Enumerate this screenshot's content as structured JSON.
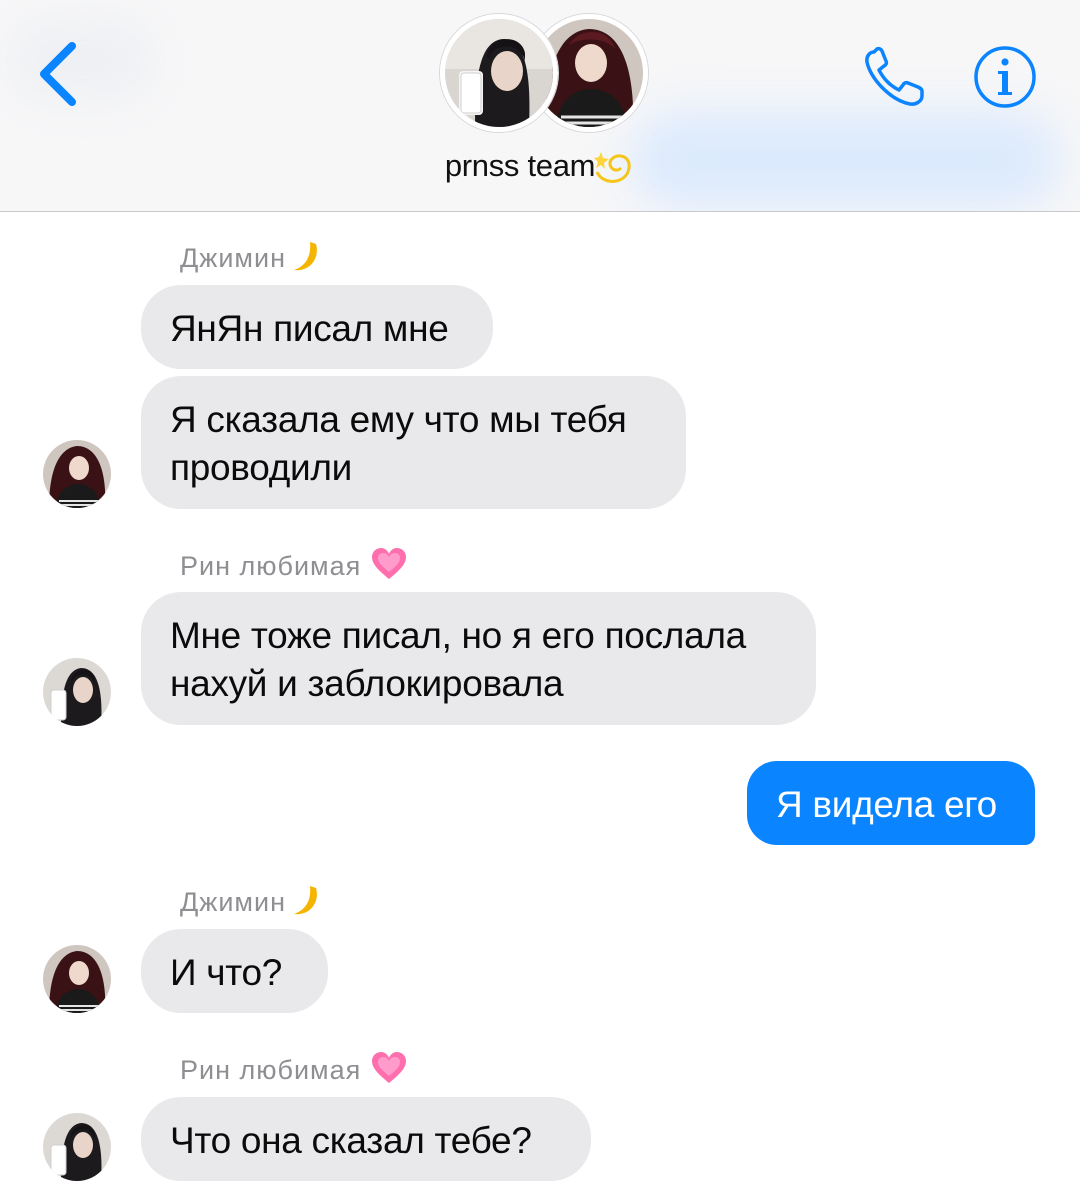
{
  "header": {
    "group_name": "prnss team",
    "group_emoji": "dizzy-emoji",
    "back_icon": "chevron-left-icon",
    "call_icon": "phone-icon",
    "info_icon": "info-icon"
  },
  "colors": {
    "accent": "#0a84ff",
    "incoming_bubble": "#e9e9eb",
    "sender_name": "#8e8e93"
  },
  "messages": [
    {
      "sender": "Джимин",
      "sender_emoji": "crescent-moon-emoji",
      "text": "ЯнЯн писал мне"
    },
    {
      "text_lines": [
        "Я сказала ему что мы тебя",
        "проводили"
      ]
    },
    {
      "sender": "Рин любимая",
      "sender_emoji": "growing-heart-emoji",
      "text_lines": [
        "Мне тоже писал, но я его послала",
        "нахуй и заблокировала"
      ]
    },
    {
      "outgoing": true,
      "text": "Я видела его"
    },
    {
      "sender": "Джимин",
      "sender_emoji": "crescent-moon-emoji",
      "text": "И что?"
    },
    {
      "sender": "Рин любимая",
      "sender_emoji": "growing-heart-emoji",
      "text": "Что она сказал тебе?"
    }
  ]
}
